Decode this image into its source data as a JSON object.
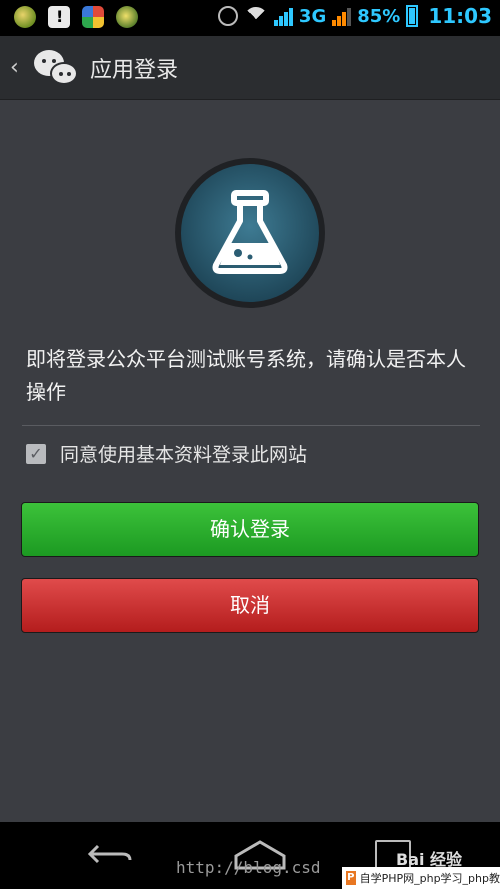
{
  "status_bar": {
    "network": "3G",
    "battery": "85%",
    "time": "11:03"
  },
  "header": {
    "back_icon": "chevron-left-icon",
    "app_icon": "wechat-icon",
    "title": "应用登录"
  },
  "main": {
    "logo_icon": "flask-icon",
    "message": "即将登录公众平台测试账号系统，请确认是否本人操作",
    "agree_checked": true,
    "agree_label": "同意使用基本资料登录此网站",
    "confirm_label": "确认登录",
    "cancel_label": "取消"
  },
  "colors": {
    "confirm": "#2aa82c",
    "cancel": "#cc2e2e",
    "logo_bg": "#2b5d73"
  },
  "nav_bar": {
    "back_icon": "back-arrow-icon",
    "home_icon": "home-icon",
    "recent_icon": "recent-apps-icon"
  },
  "watermark": {
    "url": "http://blog.csd",
    "baidu": "Bai 经验",
    "php": "自学PHP网_php学习_php教"
  }
}
